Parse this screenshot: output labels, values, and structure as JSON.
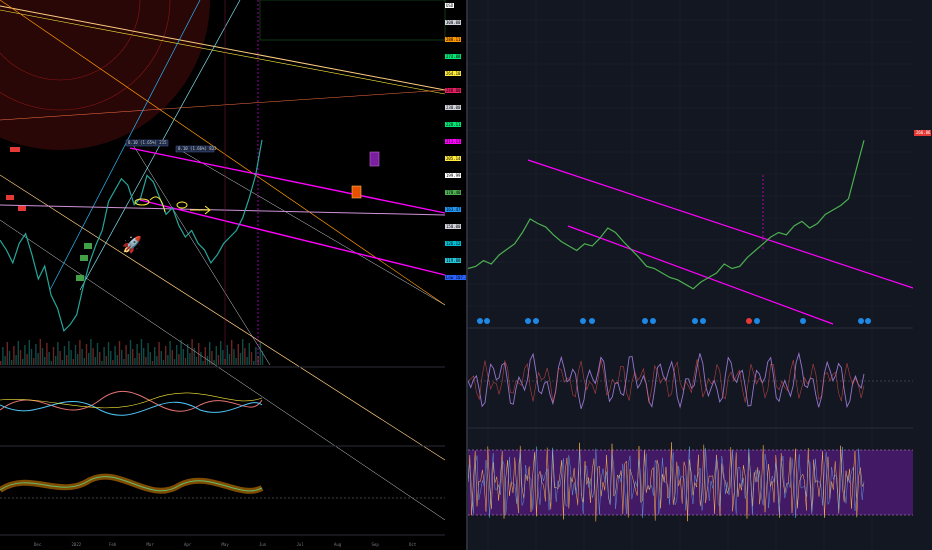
{
  "chart_data": [
    {
      "type": "line",
      "panel": "left",
      "x_tick_labels": [
        "Dec",
        "2022",
        "Feb",
        "Mar",
        "Apr",
        "May",
        "Jun",
        "Jul",
        "Aug",
        "Sep",
        "Oct"
      ],
      "price_tags": [
        {
          "text": "USD",
          "color": "#ffffff"
        },
        {
          "text": "300.00",
          "color": "#d1d4dc"
        },
        {
          "text": "288.11",
          "color": "#ff9800"
        },
        {
          "text": "274.88",
          "color": "#00e676"
        },
        {
          "text": "264.10",
          "color": "#ffeb3b"
        },
        {
          "text": "240.00",
          "color": "#e91e63"
        },
        {
          "text": "230.00",
          "color": "#d1d4dc"
        },
        {
          "text": "220.11",
          "color": "#00e676"
        },
        {
          "text": "213.11",
          "color": "#ff00ff"
        },
        {
          "text": "205.14",
          "color": "#ffeb3b"
        },
        {
          "text": "199.99",
          "color": "#ffffff"
        },
        {
          "text": "178.40",
          "color": "#4caf50"
        },
        {
          "text": "163.47",
          "color": "#2196f3"
        },
        {
          "text": "150.00",
          "color": "#d1d4dc"
        },
        {
          "text": "126.12",
          "color": "#00bcd4"
        },
        {
          "text": "119.88",
          "color": "#26c6da"
        },
        {
          "text": "Low 107.22",
          "color": "#2962ff"
        }
      ],
      "annotations": [
        "0.10 (1.65%) 215",
        "0.10 (1.66%) 823"
      ],
      "series": [
        {
          "values": [
            174,
            168,
            160,
            172,
            178,
            165,
            150,
            158,
            140,
            132,
            118,
            122,
            128,
            145,
            160,
            171,
            180,
            198,
            205,
            212,
            208,
            196,
            200,
            214,
            210,
            200,
            190,
            194,
            183,
            176,
            180,
            172,
            168,
            160,
            165,
            172,
            176,
            180,
            188,
            200,
            214,
            236
          ]
        }
      ],
      "ylim": [
        100,
        310
      ],
      "color": "#26a69a"
    },
    {
      "type": "line",
      "panel": "right",
      "title": "",
      "series": [
        {
          "values": [
            148,
            150,
            155,
            152,
            160,
            165,
            170,
            180,
            192,
            188,
            185,
            178,
            172,
            168,
            164,
            170,
            168,
            175,
            184,
            180,
            172,
            165,
            158,
            150,
            148,
            144,
            140,
            138,
            134,
            130,
            136,
            140,
            144,
            152,
            148,
            150,
            158,
            164,
            170,
            176,
            180,
            178,
            186,
            190,
            184,
            188,
            196,
            200,
            204,
            210,
            236,
            262
          ]
        }
      ],
      "price_tag": "266.86",
      "color": "#4caf50",
      "grid": true
    }
  ]
}
